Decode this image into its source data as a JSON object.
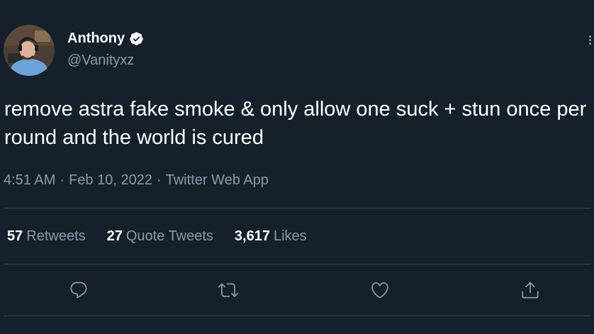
{
  "author": {
    "display_name": "Anthony",
    "handle": "@Vanityxz",
    "verified": true
  },
  "tweet": {
    "text": "remove astra fake smoke & only allow one suck + stun once per round and the world is cured",
    "time": "4:51 AM",
    "date": "Feb 10, 2022",
    "source": "Twitter Web App",
    "separator": "·"
  },
  "stats": {
    "retweets_count": "57",
    "retweets_label": "Retweets",
    "quote_tweets_count": "27",
    "quote_tweets_label": "Quote Tweets",
    "likes_count": "3,617",
    "likes_label": "Likes"
  },
  "actions": {
    "reply_icon": "reply-icon",
    "retweet_icon": "retweet-icon",
    "like_icon": "heart-icon",
    "share_icon": "share-icon"
  },
  "colors": {
    "background": "#15202b",
    "text": "#ffffff",
    "secondary": "#8b98a5",
    "divider": "#38444d",
    "verified_badge": "#ffffff"
  }
}
